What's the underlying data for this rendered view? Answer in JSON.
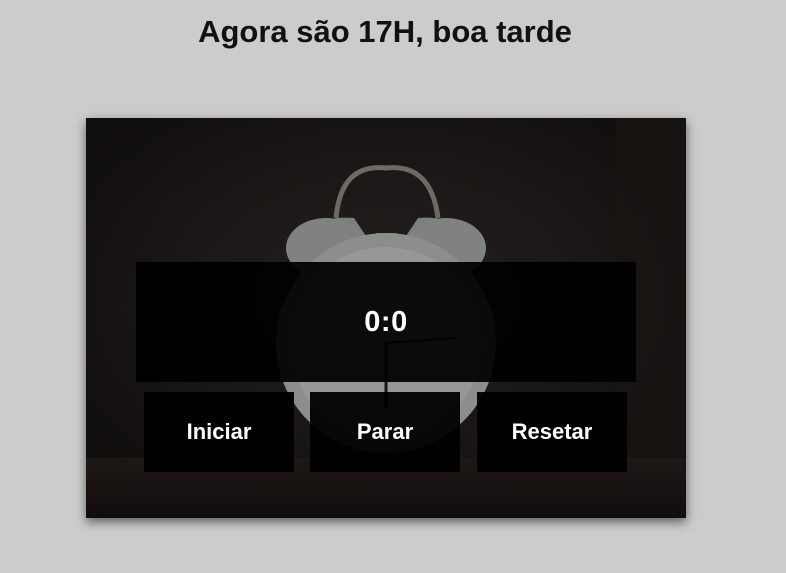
{
  "header": {
    "title": "Agora são 17H, boa tarde"
  },
  "timer": {
    "display": "0:0",
    "background_image": "alarm-clock-photo"
  },
  "controls": {
    "start_label": "Iniciar",
    "stop_label": "Parar",
    "reset_label": "Resetar"
  },
  "colors": {
    "page_background": "#cccccc",
    "panel_background": "#000000",
    "text_light": "#ffffff",
    "title_text": "#111111"
  }
}
